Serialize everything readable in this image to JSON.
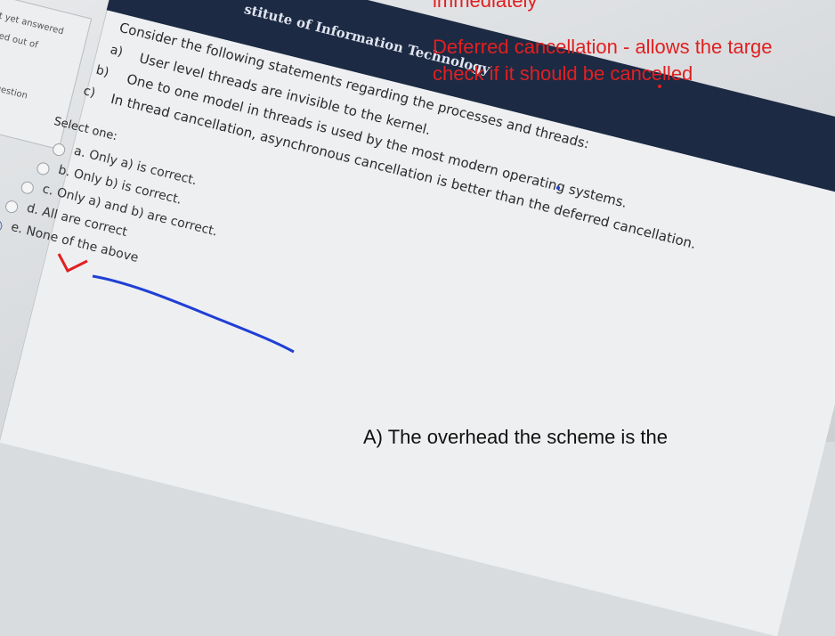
{
  "sidebar": {
    "lines": [
      "t yet answered",
      "ked out of",
      "g question"
    ]
  },
  "header": {
    "title": "stitute of Information Technology"
  },
  "question": {
    "intro": "Consider the following statements regarding the processes and threads:",
    "statements": [
      {
        "letter": "a)",
        "text": "User level threads are invisible to the kernel."
      },
      {
        "letter": "b)",
        "text": "One to one model in threads is used by the most modern operating systems."
      },
      {
        "letter": "c)",
        "text": "In thread cancellation, asynchronous cancellation is better than the deferred cancellation."
      }
    ],
    "select_label": "Select one:",
    "options": [
      {
        "label": "a. Only a) is correct.",
        "checked": false
      },
      {
        "label": "b. Only b) is correct.",
        "checked": false
      },
      {
        "label": "c. Only a) and b) are correct.",
        "checked": false
      },
      {
        "label": "d. All are correct",
        "checked": false
      },
      {
        "label": "e. None of the above",
        "checked": true
      }
    ]
  },
  "overlay": {
    "top_cut": "immediately",
    "note_line1": "Deferred cancellation - allows the targe",
    "note_line2": "check if it should be cancelled",
    "bottom": "A) The overhead the scheme is the"
  },
  "colors": {
    "header_bg": "#1d2a44",
    "annotation_red": "#e02020",
    "annotation_blue": "#1f3fd6"
  }
}
